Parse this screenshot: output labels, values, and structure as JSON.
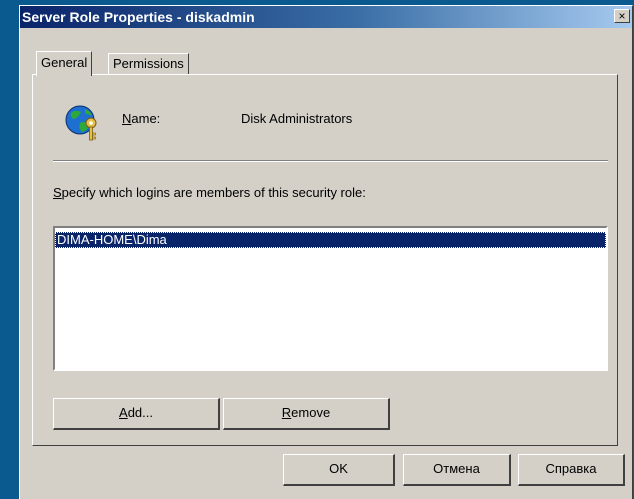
{
  "window": {
    "title": "Server Role Properties - diskadmin",
    "close_glyph": "×"
  },
  "tabs": [
    {
      "label": "General",
      "active": true
    },
    {
      "label": "Permissions",
      "active": false
    }
  ],
  "general": {
    "icon": "globe-key-icon",
    "name_label_mnemonic": "N",
    "name_label_rest": "ame:",
    "name_value": "Disk Administrators",
    "specify_mnemonic": "S",
    "specify_rest": "pecify which logins are members of this security role:",
    "members": [
      {
        "login": "DIMA-HOME\\Dima",
        "selected": true
      }
    ],
    "add_button": {
      "mnemonic": "A",
      "rest": "dd..."
    },
    "remove_button": {
      "mnemonic": "R",
      "rest": "emove"
    }
  },
  "footer": {
    "ok_label": "OK",
    "cancel_label": "Отмена",
    "help_label": "Справка"
  },
  "colors": {
    "desktop": "#0a5a8f",
    "title_gradient_start": "#0a246a",
    "title_gradient_end": "#a6caf0",
    "selection": "#0a246a",
    "face": "#d4d0c8"
  }
}
